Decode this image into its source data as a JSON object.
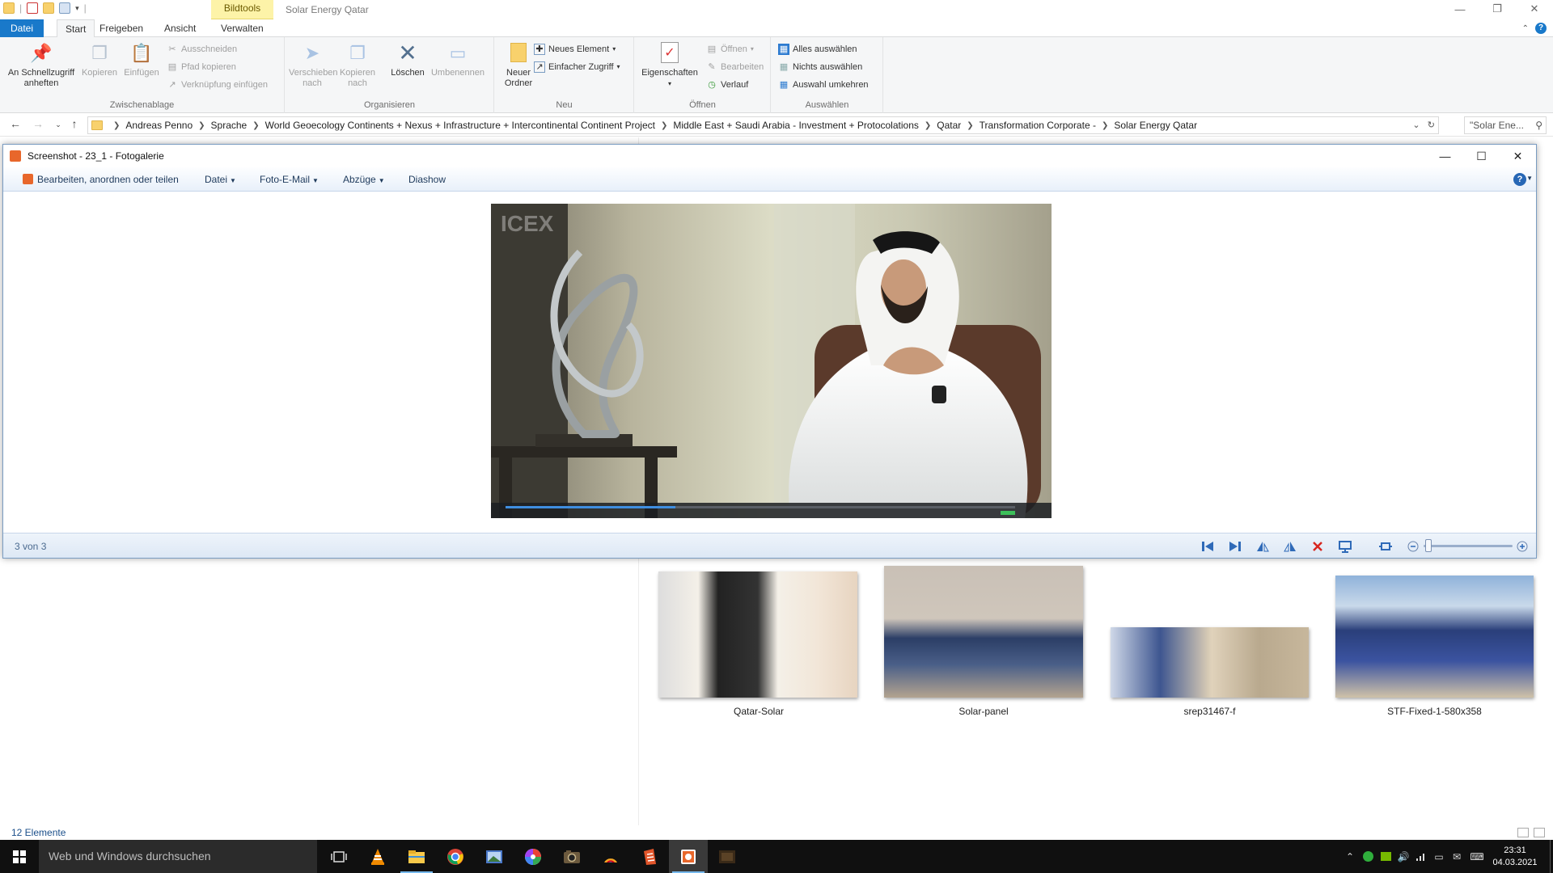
{
  "explorer": {
    "context_tab": "Bildtools",
    "window_title": "Solar Energy Qatar",
    "tabs": {
      "file": "Datei",
      "start": "Start",
      "share": "Freigeben",
      "view": "Ansicht",
      "manage": "Verwalten"
    },
    "ribbon": {
      "clipboard": {
        "label": "Zwischenablage",
        "pin": "An Schnellzugriff anheften",
        "copy": "Kopieren",
        "paste": "Einfügen",
        "cut": "Ausschneiden",
        "copy_path": "Pfad kopieren",
        "paste_shortcut": "Verknüpfung einfügen"
      },
      "organize": {
        "label": "Organisieren",
        "move_to": "Verschieben nach",
        "copy_to": "Kopieren nach",
        "delete": "Löschen",
        "rename": "Umbenennen"
      },
      "new": {
        "label": "Neu",
        "new_folder": "Neuer Ordner",
        "new_item": "Neues Element",
        "easy_access": "Einfacher Zugriff"
      },
      "open": {
        "label": "Öffnen",
        "properties": "Eigenschaften",
        "open": "Öffnen",
        "edit": "Bearbeiten",
        "history": "Verlauf"
      },
      "select": {
        "label": "Auswählen",
        "select_all": "Alles auswählen",
        "select_none": "Nichts auswählen",
        "invert": "Auswahl umkehren"
      }
    },
    "breadcrumbs": [
      "Andreas Penno",
      "Sprache",
      "World Geoecology Continents + Nexus + Infrastructure + Intercontinental Continent Project",
      "Middle East + Saudi Arabia - Investment + Protocolations",
      "Qatar",
      "Transformation Corporate -",
      "Solar Energy Qatar"
    ],
    "search_placeholder": "\"Solar Ene...",
    "thumbnails": [
      {
        "caption": "Qatar-Solar"
      },
      {
        "caption": "Solar-panel"
      },
      {
        "caption": "srep31467-f"
      },
      {
        "caption": "STF-Fixed-1-580x358"
      }
    ],
    "status": "12 Elemente"
  },
  "gallery": {
    "title": "Screenshot - 23_1 - Fotogalerie",
    "menu": {
      "edit": "Bearbeiten, anordnen oder teilen",
      "file": "Datei",
      "email": "Foto-E-Mail",
      "prints": "Abzüge",
      "slideshow": "Diashow"
    },
    "photo_watermark": "ICEX",
    "position": "3 von 3"
  },
  "taskbar": {
    "search_placeholder": "Web und Windows durchsuchen",
    "time": "23:31",
    "date": "04.03.2021"
  },
  "colors": {
    "accent": "#1979ca",
    "context_tab": "#fdf3a8",
    "taskbar": "#101010"
  }
}
